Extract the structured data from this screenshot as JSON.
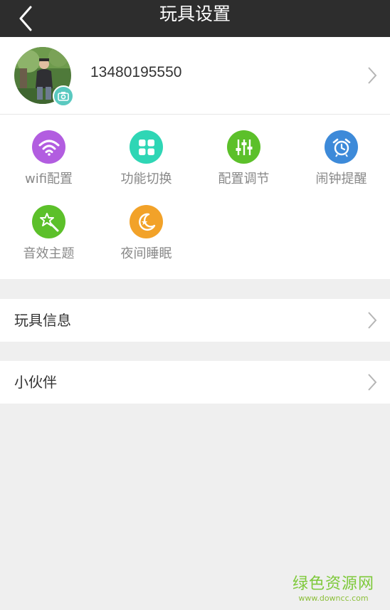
{
  "header": {
    "title": "玩具设置",
    "back_icon": "chevron-left-icon"
  },
  "profile": {
    "phone": "13480195550",
    "avatar_icon": "avatar",
    "camera_icon": "camera-icon"
  },
  "features": [
    {
      "label": "wifi配置",
      "icon": "wifi-icon",
      "color": "#b25de0"
    },
    {
      "label": "功能切换",
      "icon": "grid-icon",
      "color": "#2fd6b5"
    },
    {
      "label": "配置调节",
      "icon": "sliders-icon",
      "color": "#5cc02a"
    },
    {
      "label": "闹钟提醒",
      "icon": "alarm-clock-icon",
      "color": "#3d8ad9"
    },
    {
      "label": "音效主题",
      "icon": "magic-wand-icon",
      "color": "#5cc02a"
    },
    {
      "label": "夜间睡眠",
      "icon": "moon-icon",
      "color": "#f2a229"
    }
  ],
  "menu": [
    {
      "label": "玩具信息"
    },
    {
      "label": "小伙伴"
    }
  ],
  "watermark": {
    "main": "绿色资源网",
    "sub": "www.downcc.com"
  }
}
